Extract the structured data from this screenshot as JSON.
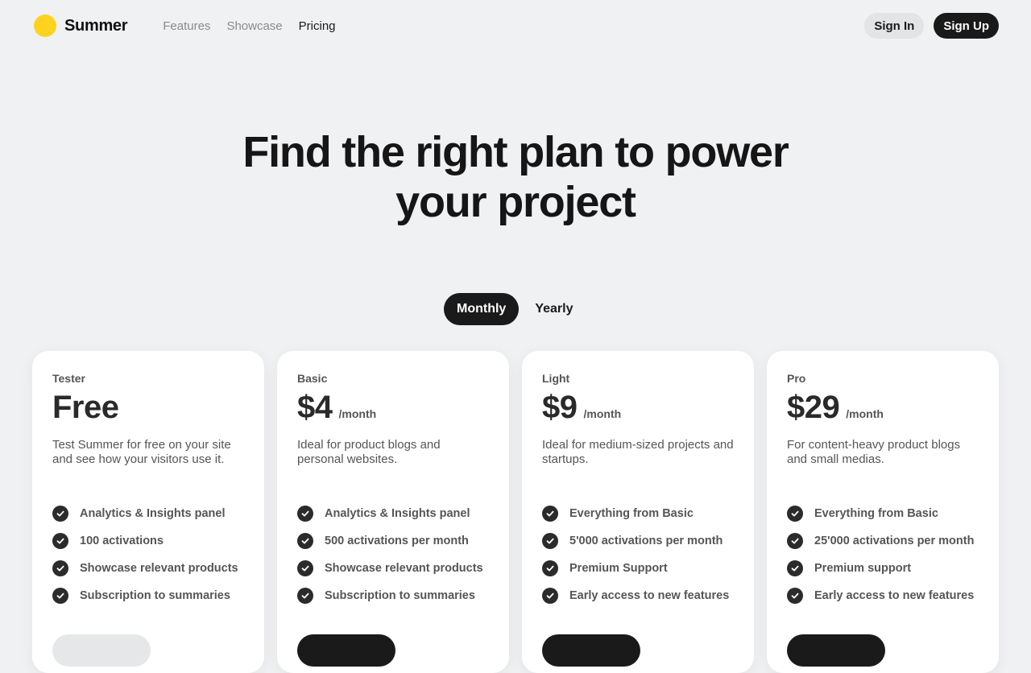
{
  "brand": {
    "name": "Summer",
    "accent": "#ffd21f",
    "dark": "#1a1a1a",
    "background": "#f0f1f3"
  },
  "nav": {
    "links": [
      {
        "label": "Features",
        "active": false
      },
      {
        "label": "Showcase",
        "active": false
      },
      {
        "label": "Pricing",
        "active": true
      }
    ],
    "sign_in": "Sign In",
    "sign_up": "Sign Up"
  },
  "hero": {
    "line1": "Find the right plan to power",
    "line2": "your project"
  },
  "billing_toggle": {
    "monthly": "Monthly",
    "yearly": "Yearly",
    "selected": "Monthly"
  },
  "plans": [
    {
      "name": "Tester",
      "price": "Free",
      "period": "",
      "description": "Test Summer for free on your site and see how your visitors use it.",
      "features": [
        "Analytics & Insights panel",
        "100 activations",
        "Showcase relevant products",
        "Subscription to summaries"
      ],
      "cta": ""
    },
    {
      "name": "Basic",
      "price": "$4",
      "period": "/month",
      "description": "Ideal for product blogs and personal websites.",
      "features": [
        "Analytics & Insights panel",
        "500 activations per month",
        "Showcase relevant products",
        "Subscription to summaries"
      ],
      "cta": ""
    },
    {
      "name": "Light",
      "price": "$9",
      "period": "/month",
      "description": "Ideal for medium-sized projects and startups.",
      "features": [
        "Everything from Basic",
        "5'000 activations per month",
        "Premium Support",
        "Early access to new features"
      ],
      "cta": ""
    },
    {
      "name": "Pro",
      "price": "$29",
      "period": "/month",
      "description": "For content-heavy product blogs and small medias.",
      "features": [
        "Everything from Basic",
        "25'000 activations per month",
        "Premium support",
        "Early access to new features"
      ],
      "cta": ""
    }
  ]
}
